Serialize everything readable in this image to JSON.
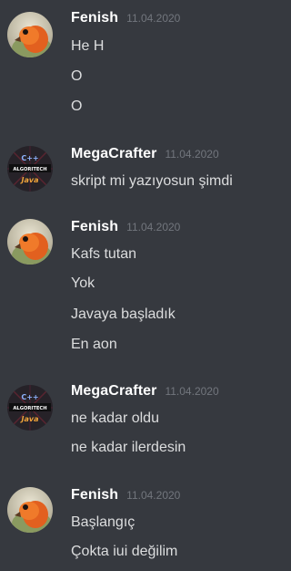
{
  "groups": [
    {
      "author": "Fenish",
      "timestamp": "11.04.2020",
      "avatar": "fenish-bird-avatar",
      "messages": [
        "He H",
        "O",
        "O"
      ]
    },
    {
      "author": "MegaCrafter",
      "timestamp": "11.04.2020",
      "avatar": "megacrafter-algoritech-avatar",
      "avatar_text": {
        "top": "C++",
        "middle": "ALGORITECH",
        "bottom": "Java"
      },
      "messages": [
        "skript mi yazıyosun şimdi"
      ]
    },
    {
      "author": "Fenish",
      "timestamp": "11.04.2020",
      "avatar": "fenish-bird-avatar",
      "messages": [
        "Kafs tutan",
        "Yok",
        "Javaya başladık",
        "En aon"
      ]
    },
    {
      "author": "MegaCrafter",
      "timestamp": "11.04.2020",
      "avatar": "megacrafter-algoritech-avatar",
      "avatar_text": {
        "top": "C++",
        "middle": "ALGORITECH",
        "bottom": "Java"
      },
      "messages": [
        "ne kadar oldu",
        "ne kadar ilerdesin"
      ]
    },
    {
      "author": "Fenish",
      "timestamp": "11.04.2020",
      "avatar": "fenish-bird-avatar",
      "messages": [
        "Başlangıç",
        "Çokta iui değilim"
      ]
    }
  ],
  "colors": {
    "background": "#36393f",
    "username": "#ffffff",
    "timestamp": "#72767d",
    "message_text": "#dcddde"
  }
}
